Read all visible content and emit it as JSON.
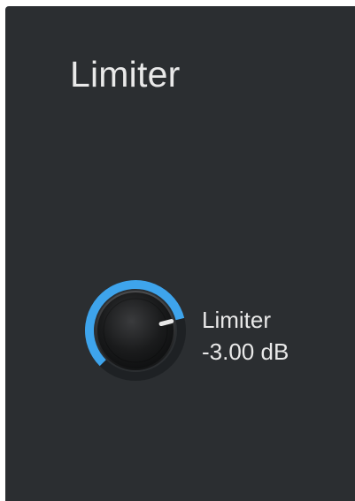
{
  "panel": {
    "title": "Limiter"
  },
  "limiter_knob": {
    "name": "Limiter",
    "value": -3.0,
    "value_text": "-3.00 dB",
    "fill_fraction": 0.78,
    "accent_color": "#3ea4ec",
    "track_color": "#1e2124",
    "indicator_color": "#e8e8e8"
  }
}
